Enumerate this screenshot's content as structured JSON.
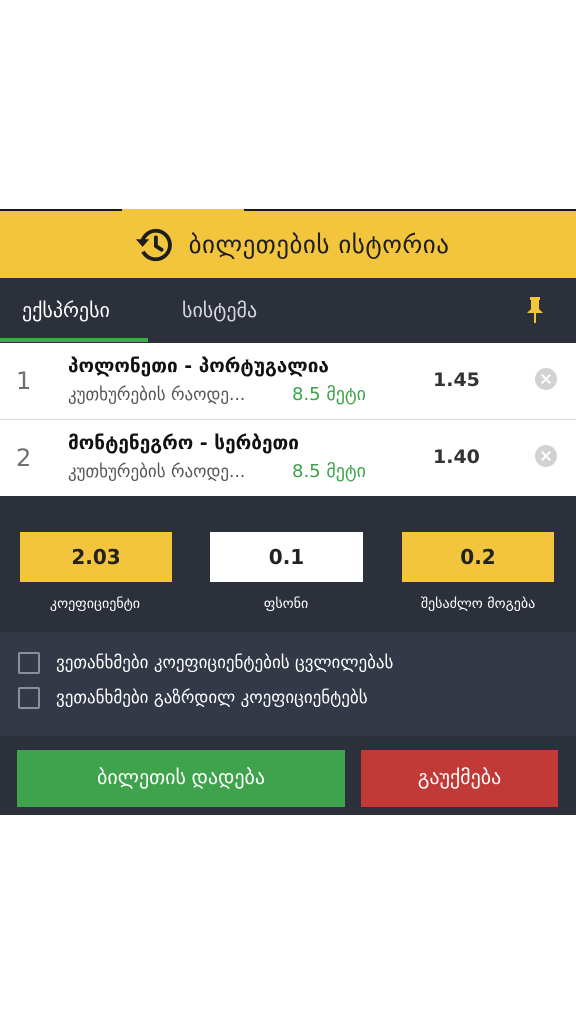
{
  "header": {
    "title": "ბილეთების ისტორია",
    "icon": "history-icon"
  },
  "tabs": [
    {
      "label": "ექსპრესი",
      "active": true
    },
    {
      "label": "სისტემა",
      "active": false
    }
  ],
  "bets": [
    {
      "num": "1",
      "match": "პოლონეთი - პორტუგალია",
      "market": "კუთხურების რაოდე...",
      "pick": "8.5 მეტი",
      "odd": "1.45"
    },
    {
      "num": "2",
      "match": "მონტენეგრო - სერბეთი",
      "market": "კუთხურების რაოდე...",
      "pick": "8.5 მეტი",
      "odd": "1.40"
    }
  ],
  "values": {
    "odds": {
      "value": "2.03",
      "label": "კოეფიციენტი"
    },
    "stake": {
      "value": "0.1",
      "label": "ფსონი"
    },
    "win": {
      "value": "0.2",
      "label": "შესაძლო მოგება"
    }
  },
  "checks": [
    {
      "label": "ვეთანხმები კოეფიციენტების ცვლილებას"
    },
    {
      "label": "ვეთანხმები გაზრდილ კოეფიციენტებს"
    }
  ],
  "actions": {
    "place_label": "ბილეთის დადება",
    "cancel_label": "გაუქმება"
  },
  "colors": {
    "accent": "#f2c53d",
    "panel": "#2b303a",
    "green": "#3fa34d",
    "red": "#c23a37"
  }
}
